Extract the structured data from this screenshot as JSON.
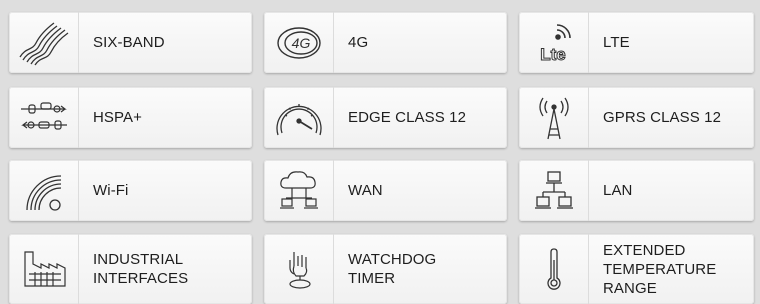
{
  "features": [
    {
      "icon": "six-band-wave-icon",
      "lines": [
        "SIX-BAND"
      ]
    },
    {
      "icon": "4g-icon",
      "lines": [
        "4G"
      ],
      "badge": "4G"
    },
    {
      "icon": "lte-icon",
      "lines": [
        "LTE"
      ],
      "badge": "Lte"
    },
    {
      "icon": "hspa-plus-icon",
      "lines": [
        "HSPA+"
      ]
    },
    {
      "icon": "speedometer-icon",
      "lines": [
        "EDGE CLASS 12"
      ]
    },
    {
      "icon": "antenna-icon",
      "lines": [
        "GPRS CLASS 12"
      ]
    },
    {
      "icon": "wifi-icon",
      "lines": [
        "Wi-Fi"
      ]
    },
    {
      "icon": "wan-cloud-icon",
      "lines": [
        "WAN"
      ]
    },
    {
      "icon": "lan-network-icon",
      "lines": [
        "LAN"
      ]
    },
    {
      "icon": "factory-icon",
      "lines": [
        "INDUSTRIAL",
        "INTERFACES"
      ]
    },
    {
      "icon": "watchdog-hand-icon",
      "lines": [
        "WATCHDOG",
        "TIMER"
      ]
    },
    {
      "icon": "thermometer-icon",
      "lines": [
        "EXTENDED",
        "TEMPERATURE",
        "RANGE"
      ]
    }
  ]
}
